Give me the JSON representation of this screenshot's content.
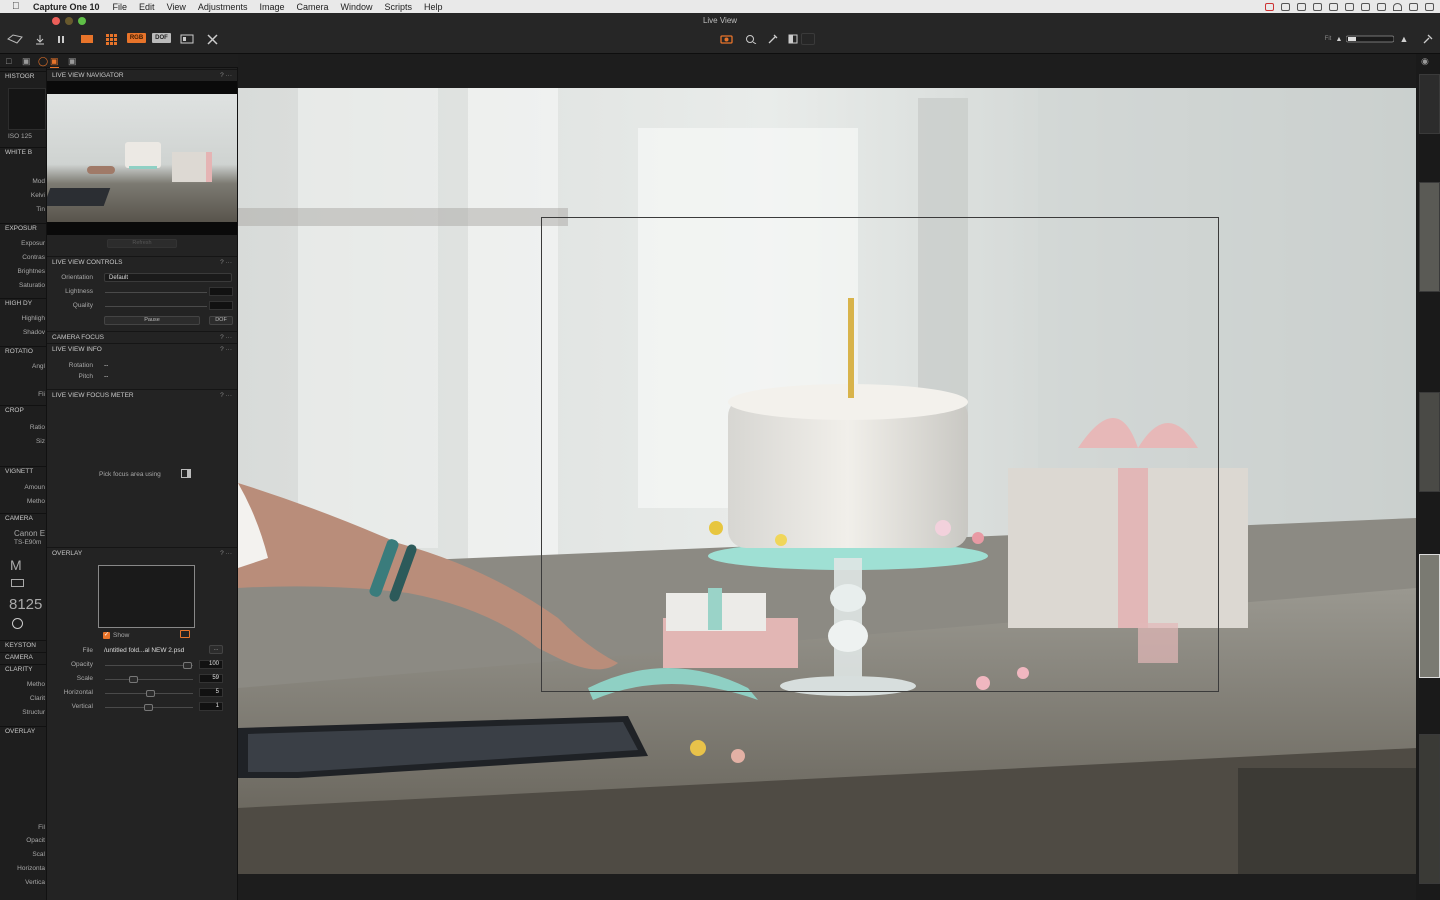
{
  "menubar": {
    "app_name": "Capture One 10",
    "items": [
      "File",
      "Edit",
      "View",
      "Adjustments",
      "Image",
      "Camera",
      "Window",
      "Scripts",
      "Help"
    ]
  },
  "window": {
    "title": "Live View"
  },
  "toolbar": {
    "badge_rgb": "RGB",
    "badge_dof": "DOF",
    "zoom_label": "Fit"
  },
  "colors": {
    "accent_orange": "#e8742a",
    "close": "#ec5f59",
    "minimize": "#e4b93b",
    "maximize": "#5fbf47"
  },
  "left_col_a": {
    "headers": [
      "HISTOGR",
      "WHITE B",
      "EXPOSUR",
      "HIGH DY",
      "ROTATIO",
      "CROP",
      "VIGNETT",
      "CAMERA",
      "KEYSTON",
      "CAMERA",
      "CLARITY",
      "OVERLAY"
    ],
    "iso": "ISO 125",
    "wb_labels": [
      "Mod",
      "Kelvi",
      "Tin"
    ],
    "exposure_labels": [
      "Exposur",
      "Contras",
      "Brightnes",
      "Saturatio"
    ],
    "hdr_labels": [
      "Highligh",
      "Shadov"
    ],
    "rotation_labels": [
      "Angl",
      "Fli"
    ],
    "crop_labels": [
      "Ratio",
      "Siz"
    ],
    "vignette_labels": [
      "Amoun",
      "Metho"
    ],
    "camera_lines": [
      "Canon E",
      "TS-E90m"
    ],
    "mode": "M",
    "shutter": "8125",
    "clarity_labels": [
      "Metho",
      "Clarit",
      "Structur"
    ],
    "overlay_labels": [
      "Fil",
      "Opacit",
      "Scal",
      "Horizonta",
      "Vertica"
    ]
  },
  "navigator": {
    "title": "LIVE VIEW NAVIGATOR",
    "refresh": "Refresh"
  },
  "controls": {
    "title": "LIVE VIEW CONTROLS",
    "orientation_label": "Orientation",
    "orientation_value": "Default",
    "lightness_label": "Lightness",
    "quality_label": "Quality",
    "pause": "Pause",
    "dof": "DOF"
  },
  "camera_focus": {
    "title": "CAMERA FOCUS"
  },
  "info": {
    "title": "LIVE VIEW INFO",
    "rotation_label": "Rotation",
    "rotation_value": "--",
    "pitch_label": "Pitch",
    "pitch_value": "--"
  },
  "focus_meter": {
    "title": "LIVE VIEW FOCUS METER",
    "pick_label": "Pick focus area using"
  },
  "overlay": {
    "title": "OVERLAY",
    "show_label": "Show",
    "file_label": "File",
    "file_value": "/untitled fold...al NEW 2.psd",
    "browse": "...",
    "opacity_label": "Opacity",
    "opacity_value": "100",
    "opacity": 1.0,
    "scale_label": "Scale",
    "scale_value": "59",
    "scale": 0.31,
    "horizontal_label": "Horizontal",
    "horizontal_value": "5",
    "horizontal": 0.53,
    "vertical_label": "Vertical",
    "vertical_value": "1",
    "vertical": 0.5
  },
  "help_glyph": "?  ···"
}
